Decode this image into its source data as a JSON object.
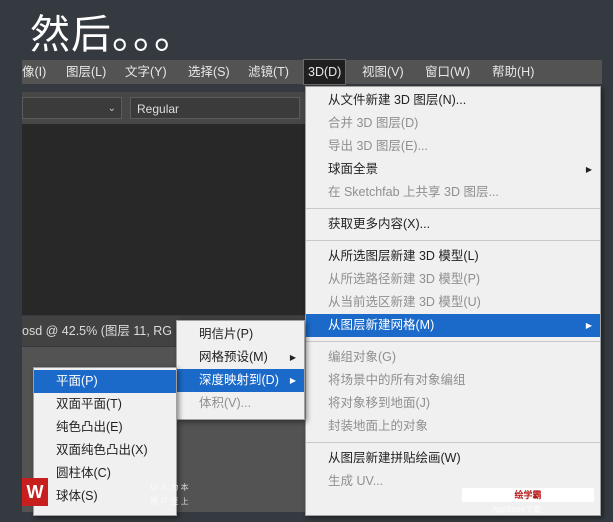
{
  "headline": "然后。。。",
  "menubar": {
    "items": [
      {
        "label": "像(I)"
      },
      {
        "label": "图层(L)"
      },
      {
        "label": "文字(Y)"
      },
      {
        "label": "选择(S)"
      },
      {
        "label": "滤镜(T)"
      },
      {
        "label": "3D(D)"
      },
      {
        "label": "视图(V)"
      },
      {
        "label": "窗口(W)"
      },
      {
        "label": "帮助(H)"
      }
    ]
  },
  "options": {
    "font_style": "Regular"
  },
  "document": {
    "tab_text": "osd @ 42.5% (图层 11, RG"
  },
  "menu_3d": [
    {
      "label": "从文件新建 3D 图层(N)...",
      "disabled": false
    },
    {
      "label": "合并 3D 图层(D)",
      "disabled": true
    },
    {
      "label": "导出 3D 图层(E)...",
      "disabled": true
    },
    {
      "label": "球面全景",
      "disabled": false,
      "submenu": true
    },
    {
      "label": "在 Sketchfab 上共享 3D 图层...",
      "disabled": true
    },
    {
      "label": "获取更多内容(X)...",
      "disabled": false
    },
    {
      "label": "从所选图层新建 3D 模型(L)",
      "disabled": false
    },
    {
      "label": "从所选路径新建 3D 模型(P)",
      "disabled": true
    },
    {
      "label": "从当前选区新建 3D 模型(U)",
      "disabled": true
    },
    {
      "label": "从图层新建网格(M)",
      "disabled": false,
      "submenu": true,
      "highlighted": true
    },
    {
      "label": "编组对象(G)",
      "disabled": true
    },
    {
      "label": "将场景中的所有对象编组",
      "disabled": true
    },
    {
      "label": "将对象移到地面(J)",
      "disabled": true
    },
    {
      "label": "封装地面上的对象",
      "disabled": true
    },
    {
      "label": "从图层新建拼贴绘画(W)",
      "disabled": false
    },
    {
      "label": "生成 UV...",
      "disabled": true
    }
  ],
  "menu_mesh": [
    {
      "label": "明信片(P)"
    },
    {
      "label": "网格预设(M)",
      "submenu": true
    },
    {
      "label": "深度映射到(D)",
      "submenu": true,
      "highlighted": true
    },
    {
      "label": "体积(V)...",
      "disabled": true
    }
  ],
  "menu_depth": [
    {
      "label": "平面(P)",
      "highlighted": true
    },
    {
      "label": "双面平面(T)"
    },
    {
      "label": "纯色凸出(E)"
    },
    {
      "label": "双面纯色凸出(X)"
    },
    {
      "label": "圆柱体(C)"
    },
    {
      "label": "球体(S)"
    }
  ],
  "watermark": {
    "logo": "W",
    "badge": "绘学霸",
    "line1": "以 人 为 本",
    "line2": "用 户 至 上",
    "site": "AppStore下载"
  },
  "icons": {
    "submenu_arrow": "triangle-right-icon",
    "dropdown": "chevron-down-icon"
  }
}
